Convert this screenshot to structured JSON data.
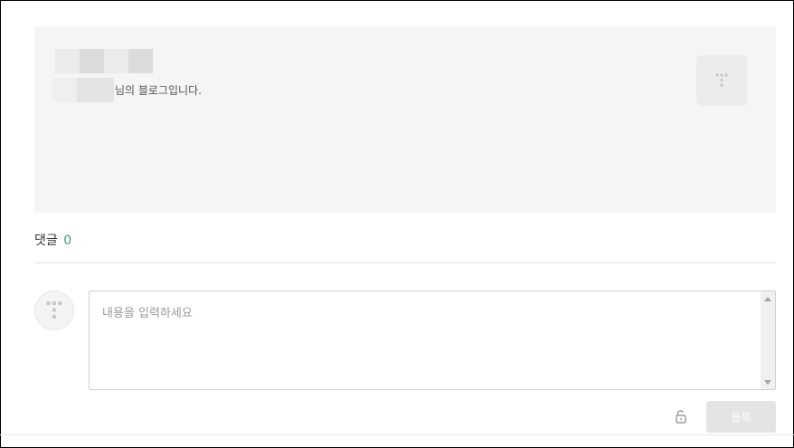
{
  "profile": {
    "blog_suffix": "님의 블로그입니다.",
    "redacted_name_colors": [
      "#ebebeb",
      "#dcdcdc",
      "#ebebeb",
      "#dcdcdc"
    ],
    "redacted_id_colors": [
      "#efefef",
      "#e4e4e4"
    ],
    "logo_icon": "tistory-logo-icon"
  },
  "comments": {
    "title": "댓글",
    "count": "0"
  },
  "comment_form": {
    "avatar_icon": "tistory-avatar-icon",
    "placeholder": "내용을 입력하세요",
    "value": "",
    "lock_icon": "lock-icon",
    "submit_label": "등록"
  },
  "colors": {
    "accent": "#3a9b85",
    "card_background": "#f5f5f5",
    "submit_disabled": "#e4e4e4"
  }
}
